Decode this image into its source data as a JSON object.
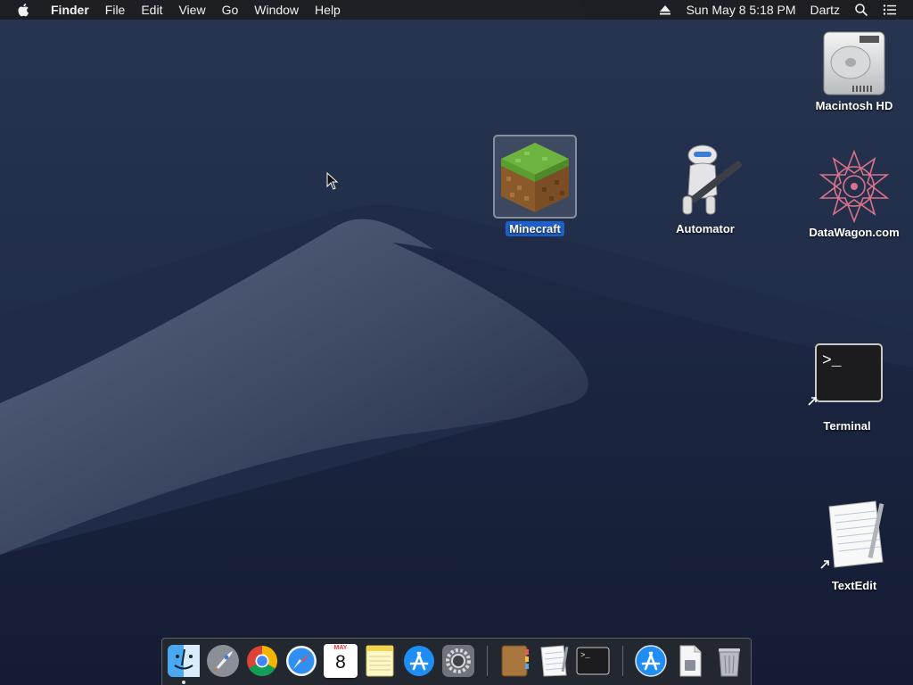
{
  "menubar": {
    "app_name": "Finder",
    "menus": [
      "File",
      "Edit",
      "View",
      "Go",
      "Window",
      "Help"
    ],
    "clock": "Sun May 8  5:18 PM",
    "user": "Dartz"
  },
  "desktop": {
    "icons": [
      {
        "label": "Macintosh HD"
      },
      {
        "label": "Minecraft"
      },
      {
        "label": "Automator"
      },
      {
        "label": "DataWagon.com"
      },
      {
        "label": "Terminal"
      },
      {
        "label": "TextEdit"
      }
    ]
  },
  "dock": {
    "calendar_month": "MAY",
    "calendar_day": "8",
    "apps": [
      "Finder",
      "Launchpad",
      "Google Chrome",
      "Safari",
      "Calendar",
      "Notes",
      "App Store",
      "System Preferences",
      "Contacts",
      "TextEdit",
      "Terminal",
      "App Store Downloads",
      "Documents",
      "Trash"
    ]
  },
  "colors": {
    "selection": "#1f5fc9",
    "menubar": "#1e1e22",
    "desktop": "#1b2540"
  }
}
